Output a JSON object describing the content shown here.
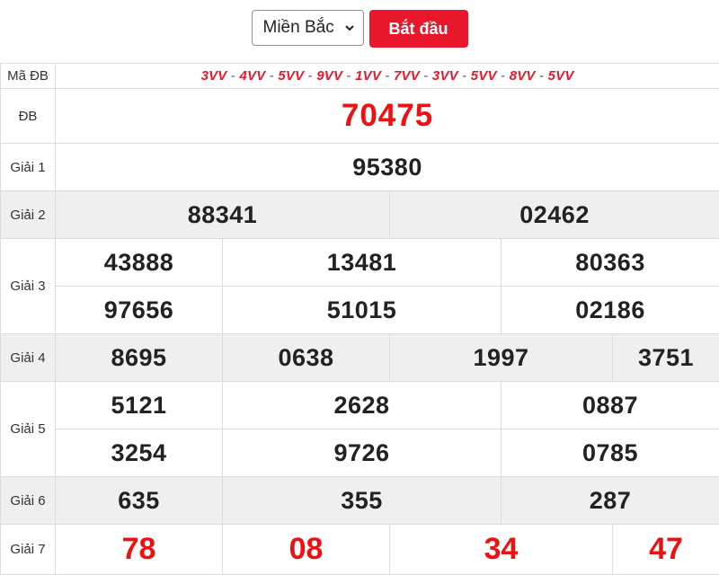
{
  "toolbar": {
    "region_select": {
      "selected": "Miền Bắc",
      "options": [
        "Miền Bắc"
      ]
    },
    "start_button_label": "Bắt đầu",
    "accent_color": "#e8172c"
  },
  "results": {
    "ma_db": {
      "label": "Mã ĐB",
      "codes": [
        "3VV",
        "4VV",
        "5VV",
        "9VV",
        "1VV",
        "7VV",
        "3VV",
        "5VV",
        "8VV",
        "5VV"
      ]
    },
    "special": {
      "label": "ĐB",
      "number": "70475"
    },
    "prize1": {
      "label": "Giải 1",
      "numbers": [
        "95380"
      ]
    },
    "prize2": {
      "label": "Giải 2",
      "numbers": [
        "88341",
        "02462"
      ]
    },
    "prize3": {
      "label": "Giải 3",
      "numbers": [
        "43888",
        "13481",
        "80363",
        "97656",
        "51015",
        "02186"
      ]
    },
    "prize4": {
      "label": "Giải 4",
      "numbers": [
        "8695",
        "0638",
        "1997",
        "3751"
      ]
    },
    "prize5": {
      "label": "Giải 5",
      "numbers": [
        "5121",
        "2628",
        "0887",
        "3254",
        "9726",
        "0785"
      ]
    },
    "prize6": {
      "label": "Giải 6",
      "numbers": [
        "635",
        "355",
        "287"
      ]
    },
    "prize7": {
      "label": "Giải 7",
      "numbers": [
        "78",
        "08",
        "34",
        "47"
      ]
    }
  }
}
